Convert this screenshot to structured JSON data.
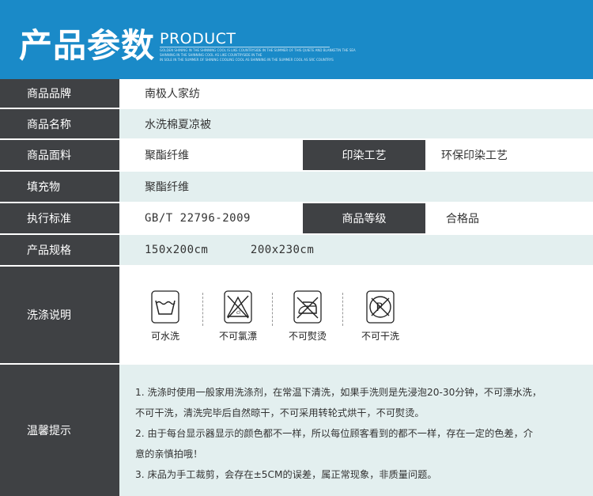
{
  "header": {
    "title_cn": "产品参数",
    "title_en": "PRODUCT",
    "fine_print": [
      "GOLDEN SHINING IN THE SHINNING COOL IS LIKE COUNTRYSIDE IN THE SUMMER OF THIS QUIETE AND BLANKETIN THE SEA",
      "SHINNING IN THE SHINNING COOL AS LIKE COUNTRYSIDE IN THE",
      "IN SOLE IN THE SUMMER OF SHINING COOLING COOL AS SHINNING IN THE SUMMER COOL AS SRC COUNTRYS"
    ]
  },
  "rows": [
    {
      "label": "商品品牌",
      "value": "南极人家纺"
    },
    {
      "label": "商品名称",
      "value": "水洗棉夏凉被"
    },
    {
      "label": "商品面料",
      "value": "聚酯纤维",
      "label2": "印染工艺",
      "value2": "环保印染工艺"
    },
    {
      "label": "填充物",
      "value": "聚酯纤维"
    },
    {
      "label": "执行标准",
      "value": "GB/T 22796-2009",
      "label2": "商品等级",
      "value2": "合格品"
    },
    {
      "label": "产品规格",
      "value": "150x200cm      200x230cm"
    }
  ],
  "care": {
    "label": "洗涤说明",
    "items": [
      {
        "icon": "washing-tub-icon",
        "caption": "可水洗"
      },
      {
        "icon": "no-bleach-icon",
        "caption": "不可氯漂"
      },
      {
        "icon": "no-iron-icon",
        "caption": "不可熨烫"
      },
      {
        "icon": "no-dry-clean-icon",
        "caption": "不可干洗"
      }
    ]
  },
  "tips": {
    "label": "温馨提示",
    "lines": [
      "1. 洗涤时使用一般家用洗涤剂，在常温下清洗，如果手洗则是先浸泡20-30分钟，不可漂水洗，",
      "不可干洗，清洗完毕后自然晾干，不可采用转轮式烘干，不可熨烫。",
      "2. 由于每台显示器显示的颜色都不一样，所以每位顾客看到的都不一样，存在一定的色差，介",
      "意的亲慎拍哦！",
      "3. 床品为手工裁剪，会存在±5CM的误差，属正常现象，非质量问题。"
    ]
  },
  "colors": {
    "header_bg": "#1a8ac8",
    "label_bg": "#3f4144",
    "tint_bg": "#e3efef"
  }
}
